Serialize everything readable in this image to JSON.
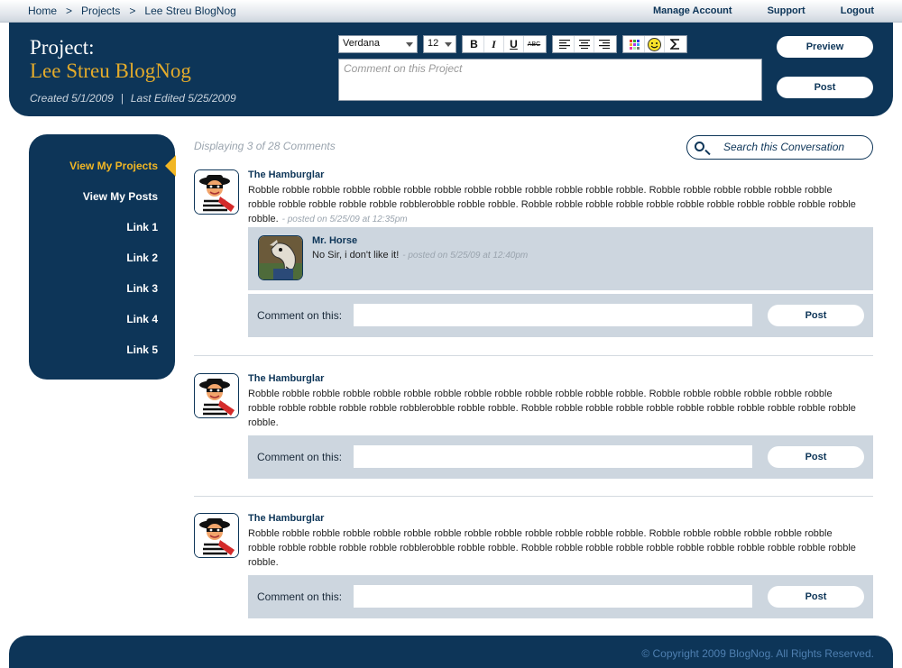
{
  "breadcrumb": [
    "Home",
    ">",
    "Projects",
    ">",
    "Lee Streu BlogNog"
  ],
  "top_links": {
    "manage_account": "Manage Account",
    "support": "Support",
    "logout": "Logout"
  },
  "project": {
    "label": "Project:",
    "name": "Lee Streu BlogNog",
    "created": "Created 5/1/2009",
    "separator": "|",
    "edited": "Last Edited 5/25/2009"
  },
  "editor": {
    "font": "Verdana",
    "size": "12",
    "format_buttons": [
      "B",
      "I",
      "U",
      "ABC"
    ],
    "comment_placeholder": "Comment on this Project",
    "preview_label": "Preview",
    "post_label": "Post"
  },
  "sidebar": {
    "items": [
      {
        "label": "View My Projects"
      },
      {
        "label": "View My Posts"
      },
      {
        "label": "Link 1"
      },
      {
        "label": "Link 2"
      },
      {
        "label": "Link 3"
      },
      {
        "label": "Link 4"
      },
      {
        "label": "Link 5"
      }
    ]
  },
  "main": {
    "displaying": "Displaying 3 of 28 Comments",
    "search_placeholder": "Search this Conversation",
    "comment_label": "Comment on this:",
    "post_label": "Post",
    "posts": [
      {
        "author": "The Hamburglar",
        "body": "Robble robble robble robble robble robble robble robble robble robble robble robble robble. Robble robble robble robble robble robble robble robble robble robble robble robblerobble robble robble.  Robble robble robble robble robble robble robble robble robble robble robble robble.",
        "meta": "- posted on 5/25/09 at 12:35pm",
        "reply": {
          "author": "Mr. Horse",
          "body": "No Sir, i don't like it!",
          "meta": "- posted on 5/25/09 at 12:40pm"
        }
      },
      {
        "author": "The Hamburglar",
        "body": "Robble robble robble robble robble robble robble robble robble robble robble robble robble. Robble robble robble robble robble robble robble robble robble robble robble robblerobble robble robble.  Robble robble robble robble robble robble robble robble robble robble robble robble."
      },
      {
        "author": "The Hamburglar",
        "body": "Robble robble robble robble robble robble robble robble robble robble robble robble robble. Robble robble robble robble robble robble robble robble robble robble robble robblerobble robble robble.  Robble robble robble robble robble robble robble robble robble robble robble robble."
      }
    ]
  },
  "footer": {
    "copyright": "© Copyright 2009 BlogNog. All Rights Reserved."
  },
  "colors": {
    "navy": "#0d3558",
    "gold": "#e3ab2b",
    "panel": "#cdd6df"
  },
  "icons": [
    "search-icon",
    "smiley-icon",
    "sigma-icon",
    "color-grid-icon",
    "align-left-icon",
    "align-center-icon",
    "align-right-icon"
  ]
}
